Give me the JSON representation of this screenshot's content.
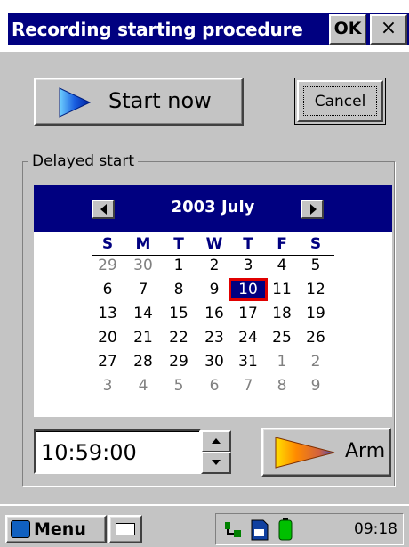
{
  "dialog": {
    "title": "Recording starting procedure",
    "ok_label": "OK",
    "close_label": "×"
  },
  "start_button": {
    "label": "Start now"
  },
  "cancel_button": {
    "label": "Cancel"
  },
  "delayed_start": {
    "group_label": "Delayed start",
    "calendar": {
      "month_label": "2003 July",
      "weekdays": [
        "S",
        "M",
        "T",
        "W",
        "T",
        "F",
        "S"
      ],
      "weeks": [
        [
          "29",
          "30",
          "1",
          "2",
          "3",
          "4",
          "5"
        ],
        [
          "6",
          "7",
          "8",
          "9",
          "10",
          "11",
          "12"
        ],
        [
          "13",
          "14",
          "15",
          "16",
          "17",
          "18",
          "19"
        ],
        [
          "20",
          "21",
          "22",
          "23",
          "24",
          "25",
          "26"
        ],
        [
          "27",
          "28",
          "29",
          "30",
          "31",
          "1",
          "2"
        ],
        [
          "3",
          "4",
          "5",
          "6",
          "7",
          "8",
          "9"
        ]
      ],
      "selected_day": "10"
    },
    "time_value": "10:59:00",
    "arm_button": {
      "label": "Arm"
    }
  },
  "taskbar": {
    "menu_label": "Menu",
    "clock": "09:18"
  },
  "colors": {
    "title_bar": "#000080",
    "face": "#c4c4c4",
    "selection_outline": "#e00000"
  }
}
